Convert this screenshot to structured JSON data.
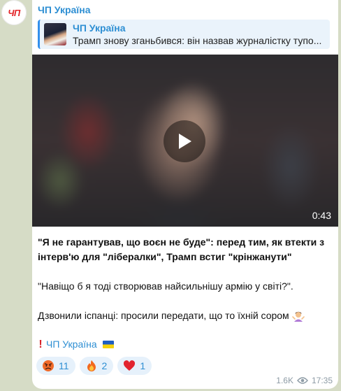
{
  "channel": {
    "avatar_text": "ЧП",
    "name": "ЧП Україна"
  },
  "reply": {
    "name": "ЧП Україна",
    "text": "Трамп знову зганьбився: він назвав журналістку тупо..."
  },
  "video": {
    "duration": "0:43",
    "icon": "play-icon"
  },
  "post": {
    "headline_line1": "\"Я не гарантував, що воєн не буде\": перед тим, як втекти з",
    "headline_line2": "інтерв'ю для \"лібералки\", Трамп встиг \"крінжанути\"",
    "quote": "\"Навіщо б я тоді створював найсильнішу армію у світі?\".",
    "comment": "Дзвонили іспанці: просили передати, що то їхній сором",
    "comment_emoji": "woman-shrugging",
    "signature_mark": "!",
    "signature_link": "ЧП Україна",
    "signature_flag": "ukraine-flag"
  },
  "reactions": [
    {
      "emoji": "angry-face-icon",
      "count": "11"
    },
    {
      "emoji": "fire-icon",
      "count": "2"
    },
    {
      "emoji": "red-heart-icon",
      "count": "1"
    }
  ],
  "meta": {
    "views": "1.6K",
    "time": "17:35"
  },
  "colors": {
    "background": "#d6dcc6",
    "accent": "#2e8fd3",
    "brand": "#e3262a"
  }
}
